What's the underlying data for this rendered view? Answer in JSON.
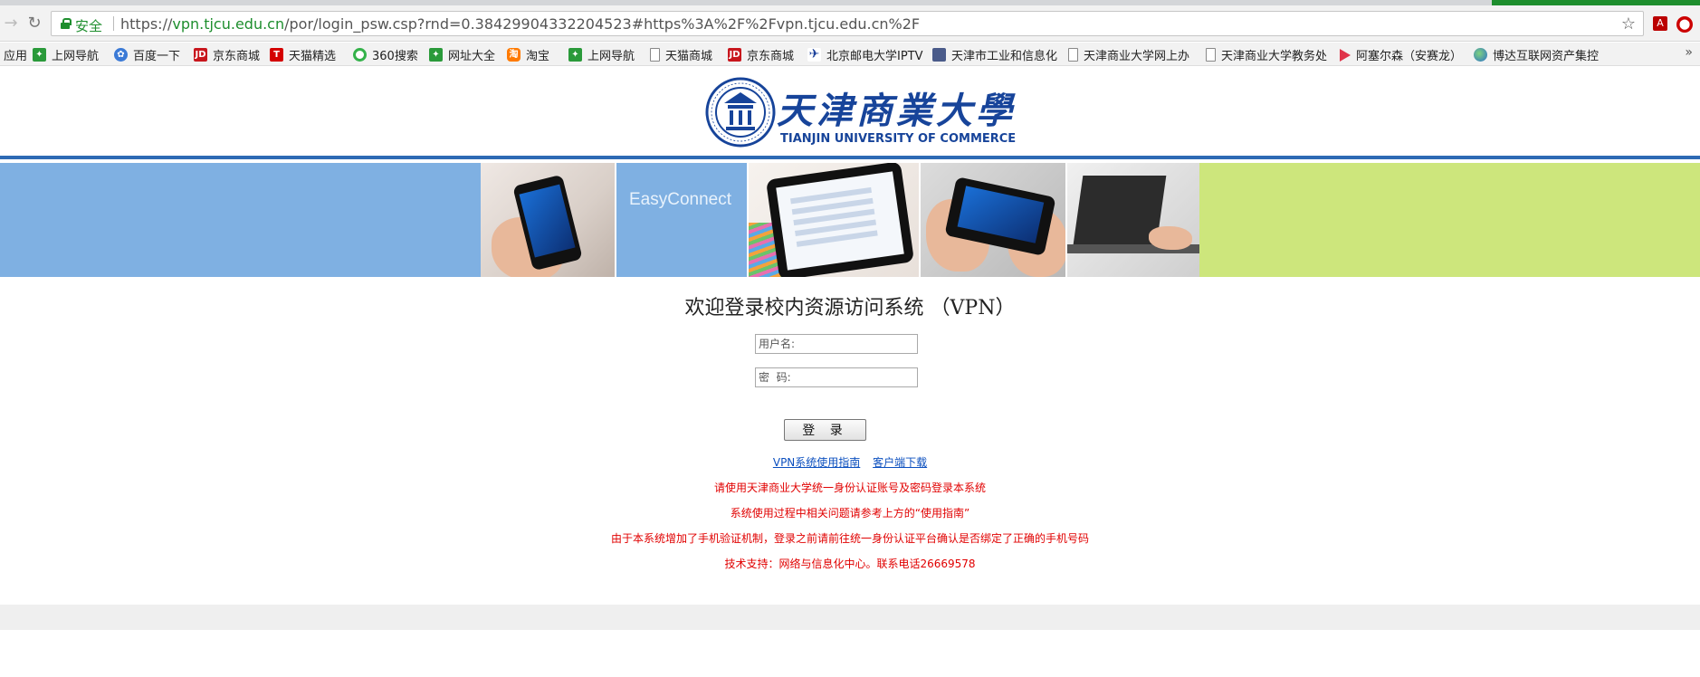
{
  "browser": {
    "secure_label": "安全",
    "url_scheme": "https://",
    "url_host": "vpn.tjcu.edu.cn",
    "url_rest": "/por/login_psw.csp?rnd=0.38429904332204523#https%3A%2F%2Fvpn.tjcu.edu.cn%2F",
    "bookmarks": [
      {
        "label": "应用",
        "icon": "none"
      },
      {
        "label": "上网导航",
        "icon": "green"
      },
      {
        "label": "百度一下",
        "icon": "blue"
      },
      {
        "label": "京东商城",
        "icon": "jd"
      },
      {
        "label": "天猫精选",
        "icon": "tm"
      },
      {
        "label": "360搜索",
        "icon": "q360"
      },
      {
        "label": "网址大全",
        "icon": "green"
      },
      {
        "label": "淘宝",
        "icon": "tb"
      },
      {
        "label": "上网导航",
        "icon": "green"
      },
      {
        "label": "天猫商城",
        "icon": "page"
      },
      {
        "label": "京东商城",
        "icon": "jd"
      },
      {
        "label": "北京邮电大学IPTV",
        "icon": "bupt"
      },
      {
        "label": "天津市工业和信息化",
        "icon": "gov"
      },
      {
        "label": "天津商业大学网上办",
        "icon": "page"
      },
      {
        "label": "天津商业大学教务处",
        "icon": "page"
      },
      {
        "label": "阿塞尔森（安赛龙）",
        "icon": "play"
      },
      {
        "label": "博达互联网资产集控",
        "icon": "globe"
      }
    ]
  },
  "header": {
    "logo_cn": "天津商業大學",
    "logo_en": "TIANJIN UNIVERSITY OF COMMERCE"
  },
  "banner": {
    "brand": "EasyConnect"
  },
  "login": {
    "title": "欢迎登录校内资源访问系统 （VPN）",
    "username_placeholder": "用户名:",
    "password_placeholder": "密  码:",
    "submit_label": "登 录",
    "guide_link": "VPN系统使用指南",
    "client_link": "客户端下载",
    "notices": [
      "请使用天津商业大学统一身份认证账号及密码登录本系统",
      "系统使用过程中相关问题请参考上方的“使用指南”",
      "由于本系统增加了手机验证机制，登录之前请前往统一身份认证平台确认是否绑定了正确的手机号码",
      "技术支持：网络与信息化中心。联系电话26669578"
    ]
  },
  "colors": {
    "header_rule": "#2d6ab4",
    "banner_blue": "#7fb0e2",
    "banner_green": "#cde67c",
    "notice_red": "#e10000",
    "link_blue": "#0b4fbf",
    "logo_blue": "#17449a"
  }
}
